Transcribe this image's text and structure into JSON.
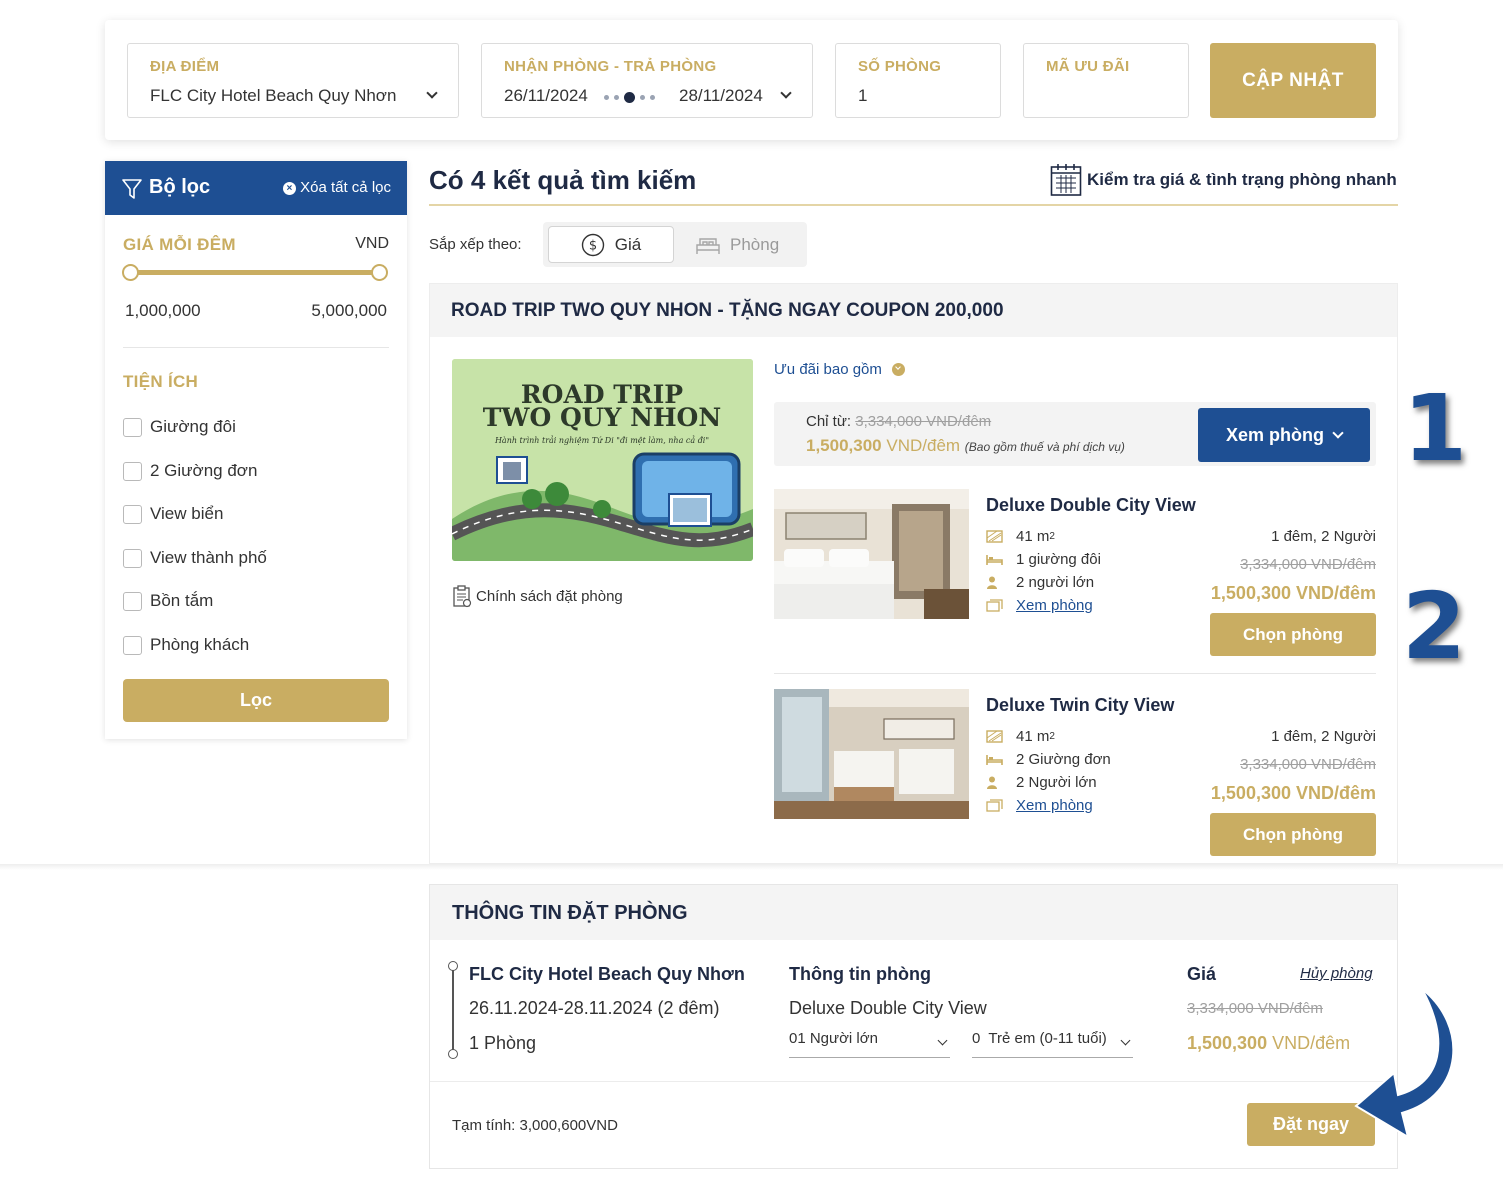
{
  "search": {
    "location_label": "ĐỊA ĐIỂM",
    "location_value": "FLC City Hotel Beach Quy Nhơn",
    "dates_label": "NHẬN PHÒNG - TRẢ PHÒNG",
    "checkin": "26/11/2024",
    "checkout": "28/11/2024",
    "rooms_label": "SỐ PHÒNG",
    "rooms_value": "1",
    "promo_label": "MÃ ƯU ĐÃI",
    "promo_value": "",
    "update_button": "CẬP NHẬT"
  },
  "filter": {
    "title": "Bộ lọc",
    "clear_all": "Xóa tất cả lọc",
    "price_label": "GIÁ MỖI ĐÊM",
    "currency": "VND",
    "price_min": "1,000,000",
    "price_max": "5,000,000",
    "amenities_label": "TIỆN ÍCH",
    "amenities": [
      "Giường đôi",
      "2 Giường đơn",
      "View biển",
      "View thành phố",
      "Bồn tắm",
      "Phòng khách"
    ],
    "filter_button": "Lọc"
  },
  "results": {
    "title": "Có 4 kết quả tìm kiếm",
    "quick_check": "Kiểm tra giá & tình trạng phòng nhanh",
    "sort_label": "Sắp xếp theo:",
    "sort_price": "Giá",
    "sort_room": "Phòng"
  },
  "offer": {
    "title": "ROAD TRIP TWO QUY NHON - TẶNG NGAY COUPON 200,000",
    "image_title_1": "ROAD TRIP",
    "image_title_2": "TWO QUY NHON",
    "image_subtitle": "Hành trình trải nghiệm Tứ Di \"đi mệt làm, nha cả đi\"",
    "policy": "Chính sách đặt phòng",
    "includes": "Ưu đãi bao gồm",
    "from_label": "Chỉ từ:",
    "from_old": "3,334,000 VND/đêm",
    "from_new": "1,500,300",
    "from_unit": "VND/đêm",
    "from_note": "(Bao gồm thuế và phí dịch vụ)",
    "view_rooms": "Xem phòng"
  },
  "rooms": [
    {
      "name": "Deluxe Double City View",
      "area": "41 m",
      "bed": "1 giường đôi",
      "guests": "2 người lớn",
      "view_link": "Xem phòng",
      "nights": "1 đêm, 2 Người",
      "old_price": "3,334,000 VND/đêm",
      "new_price": "1,500,300 VND/đêm",
      "choose": "Chọn phòng"
    },
    {
      "name": "Deluxe Twin City View",
      "area": "41 m",
      "bed": "2 Giường đơn",
      "guests": "2 Người lớn",
      "view_link": "Xem phòng",
      "nights": "1 đêm, 2 Người",
      "old_price": "3,334,000 VND/đêm",
      "new_price": "1,500,300 VND/đêm",
      "choose": "Chọn phòng"
    }
  ],
  "annotations": {
    "step1": "1",
    "step2": "2"
  },
  "booking": {
    "title": "THÔNG TIN ĐẶT PHÒNG",
    "hotel": "FLC City Hotel Beach Quy Nhơn",
    "dates": "26.11.2024-28.11.2024 (2 đêm)",
    "rooms": "1 Phòng",
    "room_info_title": "Thông tin phòng",
    "room_name": "Deluxe Double City View",
    "adults": "01 Người lớn",
    "children": "0  Trẻ em (0-11 tuổi)",
    "price_title": "Giá",
    "cancel": "Hủy phòng",
    "old_price": "3,334,000 VND/đêm",
    "new_price": "1,500,300",
    "new_unit": "VND/đêm",
    "subtotal": "Tạm tính: 3,000,600VND",
    "book_now": "Đặt ngay"
  },
  "colors": {
    "gold": "#c9ad62",
    "navy": "#1e4f93"
  }
}
